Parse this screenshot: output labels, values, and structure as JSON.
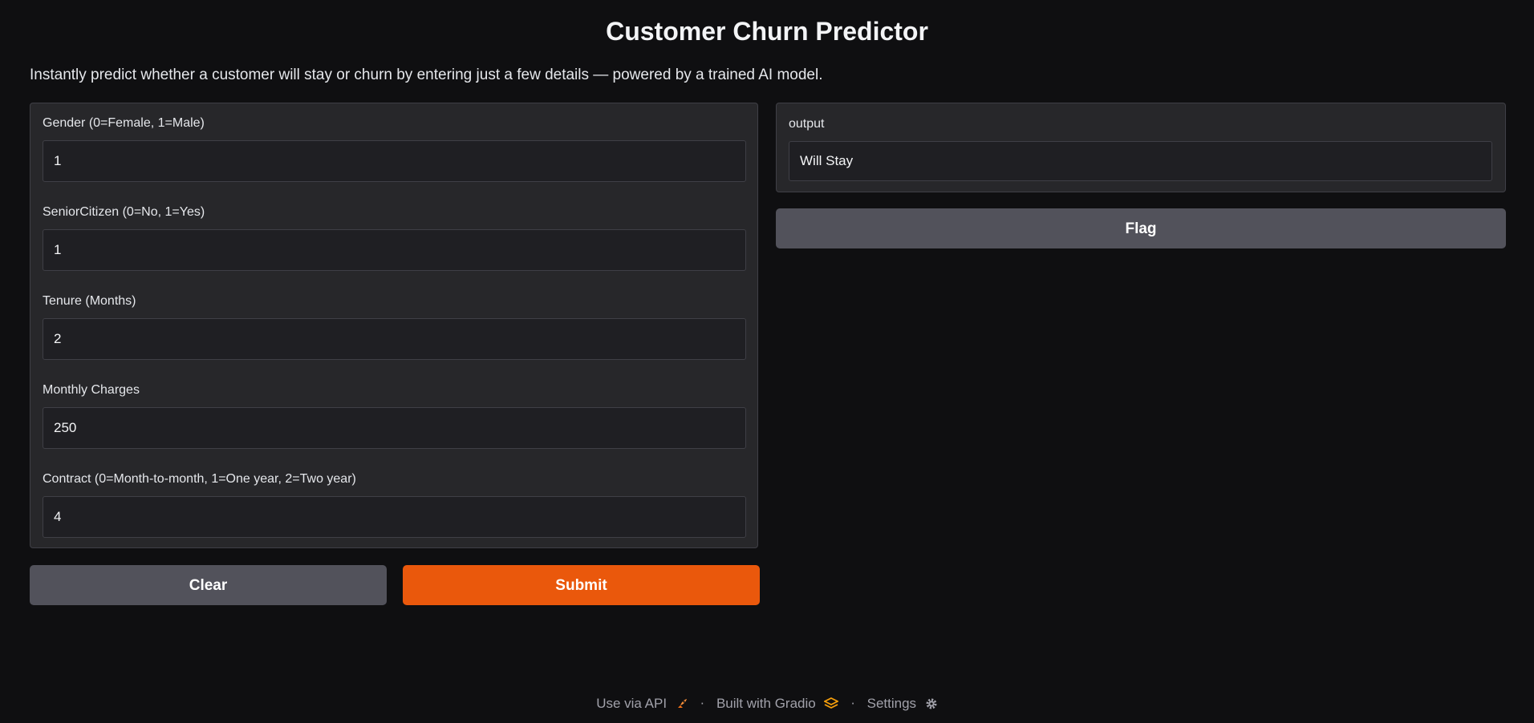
{
  "header": {
    "title": "Customer Churn Predictor",
    "description": "Instantly predict whether a customer will stay or churn by entering just a few details — powered by a trained AI model."
  },
  "inputs": [
    {
      "label": "Gender (0=Female, 1=Male)",
      "value": "1"
    },
    {
      "label": "SeniorCitizen (0=No, 1=Yes)",
      "value": "1"
    },
    {
      "label": "Tenure (Months)",
      "value": "2"
    },
    {
      "label": "Monthly Charges",
      "value": "250"
    },
    {
      "label": "Contract (0=Month-to-month, 1=One year, 2=Two year)",
      "value": "4"
    }
  ],
  "actions": {
    "clear_label": "Clear",
    "submit_label": "Submit",
    "flag_label": "Flag"
  },
  "output": {
    "label": "output",
    "value": "Will Stay"
  },
  "footer": {
    "api_label": "Use via API",
    "separator": "·",
    "built_label": "Built with Gradio",
    "settings_label": "Settings",
    "api_icon": "rocket-icon",
    "gradio_icon": "gradio-logo-icon",
    "settings_icon": "gear-icon"
  },
  "colors": {
    "background": "#0f0f11",
    "panel": "#27272a",
    "primary": "#ea580c",
    "secondary": "#52525b"
  }
}
